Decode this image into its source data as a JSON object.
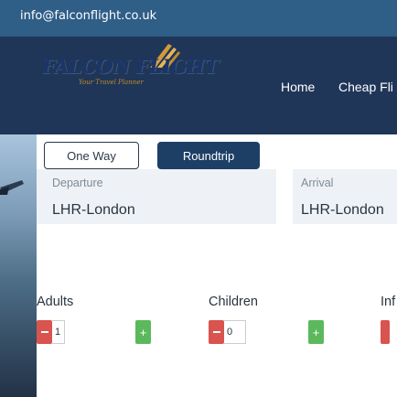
{
  "topbar": {
    "email": "info@falconflight.co.uk"
  },
  "logo": {
    "brand": "FALCON FLIGHT",
    "tagline": "Your Travel Planner"
  },
  "nav": {
    "home": "Home",
    "cheap": "Cheap Fli"
  },
  "trip": {
    "one_way": "One Way",
    "roundtrip": "Roundtrip",
    "selected": "Roundtrip"
  },
  "departure": {
    "label": "Departure",
    "value": "LHR-London"
  },
  "arrival": {
    "label": "Arrival",
    "value": "LHR-London"
  },
  "passengers": {
    "adults": {
      "label": "Adults",
      "value": "1"
    },
    "children": {
      "label": "Children",
      "value": "0"
    },
    "infants": {
      "label": "Inf"
    }
  },
  "colors": {
    "topbar": "#2f5e87",
    "header": "#1f3658",
    "roundtrip": "#1d3f66",
    "minus": "#d9534f",
    "plus": "#5cb85c"
  },
  "icons": {
    "minus": "minus-icon",
    "plus": "plus-icon",
    "wing": "falcon-wing-icon"
  }
}
